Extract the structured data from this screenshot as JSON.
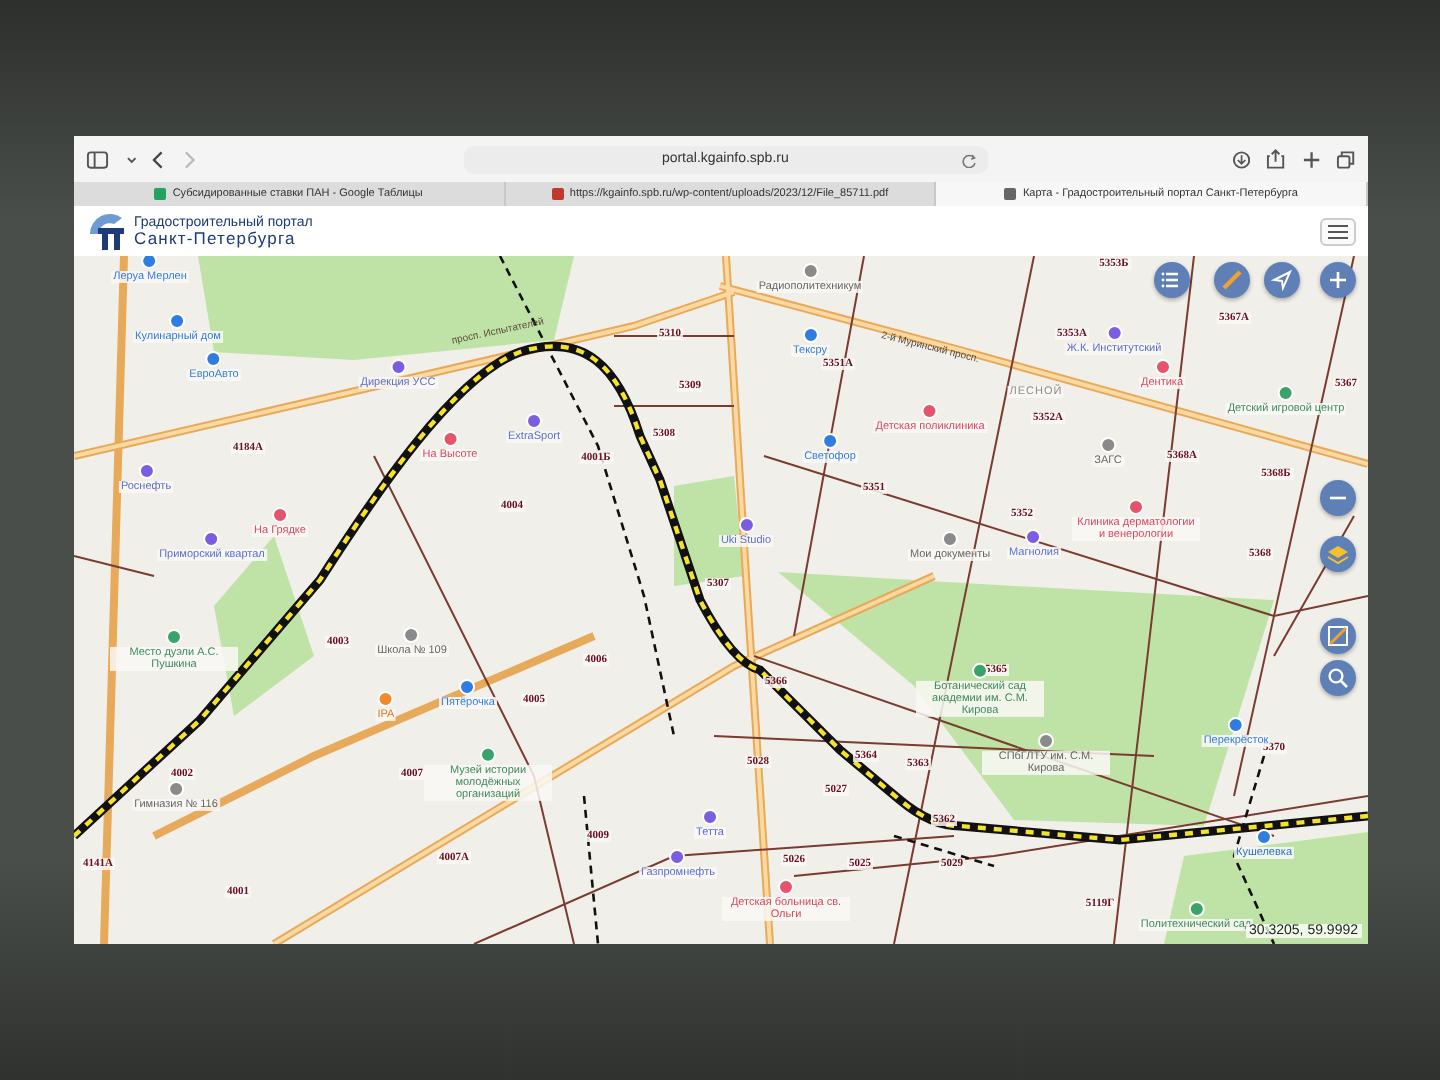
{
  "browser": {
    "url": "portal.kgainfo.spb.ru",
    "tabs": [
      {
        "title": "Субсидированные ставки ПАН - Google Таблицы",
        "kind": "sheets",
        "selected": false
      },
      {
        "title": "https://kgainfo.spb.ru/wp-content/uploads/2023/12/File_85711.pdf",
        "kind": "pdf",
        "selected": false
      },
      {
        "title": "Карта - Градостроительный портал Санкт-Петербурга",
        "kind": "portal",
        "selected": true
      }
    ]
  },
  "portal": {
    "title_line_1": "Градостроительный портал",
    "title_line_2": "Санкт-Петербурга"
  },
  "map": {
    "streets": [
      "просп. Испытателей",
      "2-й Муринский просп."
    ],
    "parcels": [
      "5310",
      "5309",
      "5308",
      "4184А",
      "4001Б",
      "4004",
      "5307",
      "5353Б",
      "5353А",
      "5351А",
      "5352А",
      "5368А",
      "5368Б",
      "5367",
      "5367А",
      "5351",
      "5352",
      "5368",
      "4003",
      "4006",
      "4005",
      "4002",
      "4007",
      "4009",
      "4007А",
      "4001",
      "4141А",
      "5366",
      "5365",
      "5028",
      "5364",
      "5363",
      "5027",
      "5362",
      "5025",
      "5029",
      "5026",
      "5370",
      "5119Г"
    ],
    "places": [
      {
        "name": "Леруа Мерлен",
        "kind": "shop"
      },
      {
        "name": "Кулинарный дом",
        "kind": "shop"
      },
      {
        "name": "ЕвроАвто",
        "kind": "shop"
      },
      {
        "name": "Дирекция УСС",
        "kind": "service"
      },
      {
        "name": "ExtraSport",
        "kind": "service"
      },
      {
        "name": "На Высоте",
        "kind": "medical"
      },
      {
        "name": "Роснефть",
        "kind": "service"
      },
      {
        "name": "На Грядке",
        "kind": "medical"
      },
      {
        "name": "Приморский квартал",
        "kind": "service"
      },
      {
        "name": "Радиополитехникум",
        "kind": "public"
      },
      {
        "name": "Тексру",
        "kind": "shop"
      },
      {
        "name": "Ж.К. Институтский",
        "kind": "service"
      },
      {
        "name": "Дентика",
        "kind": "medical"
      },
      {
        "name": "ЛЕСНОЙ",
        "kind": "district"
      },
      {
        "name": "Детская поликлиника",
        "kind": "medical"
      },
      {
        "name": "ЗАГС",
        "kind": "public"
      },
      {
        "name": "Детский игровой центр",
        "kind": "culture"
      },
      {
        "name": "Светофор",
        "kind": "shop"
      },
      {
        "name": "Uki Studio",
        "kind": "service"
      },
      {
        "name": "Мои документы",
        "kind": "public"
      },
      {
        "name": "Магнолия",
        "kind": "service"
      },
      {
        "name": "Клиника дерматологии и венерологии",
        "kind": "medical"
      },
      {
        "name": "Место дуэли А.С. Пушкина",
        "kind": "culture"
      },
      {
        "name": "Школа № 109",
        "kind": "public"
      },
      {
        "name": "IPA",
        "kind": "food"
      },
      {
        "name": "Пятёрочка",
        "kind": "shop"
      },
      {
        "name": "Гимназия № 116",
        "kind": "public"
      },
      {
        "name": "Музей истории молодёжных организаций",
        "kind": "culture"
      },
      {
        "name": "Тетта",
        "kind": "service"
      },
      {
        "name": "Газпромнефть",
        "kind": "service"
      },
      {
        "name": "Ботанический сад академии им. С.М. Кирова",
        "kind": "culture"
      },
      {
        "name": "СПбГЛТУ им. С.М. Кирова",
        "kind": "public"
      },
      {
        "name": "Детская больница св. Ольги",
        "kind": "medical"
      },
      {
        "name": "Перекрёсток",
        "kind": "shop"
      },
      {
        "name": "Кушелевка",
        "kind": "station"
      },
      {
        "name": "Политехнический сад",
        "kind": "culture"
      }
    ],
    "coordinates": "30.3205, 59.9992"
  }
}
